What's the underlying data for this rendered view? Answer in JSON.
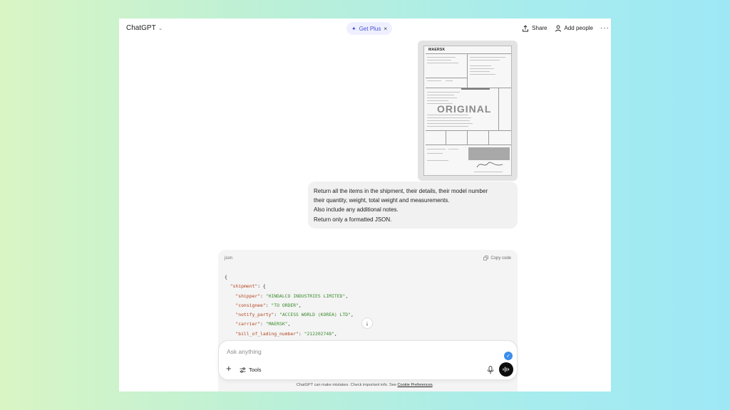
{
  "app": {
    "title": "ChatGPT",
    "get_plus_label": "Get Plus",
    "share_label": "Share",
    "add_people_label": "Add people"
  },
  "attachment": {
    "logo_text": "MAERSK",
    "watermark_text": "ORIGINAL"
  },
  "user_message": {
    "lines": [
      "Return all the items in the shipment, their details, their model number",
      "their quantity, weight, total weight and measurements.",
      "Also include any additional notes.",
      "Return only a formatted JSON."
    ]
  },
  "code_block": {
    "language": "json",
    "copy_label": "Copy code",
    "lines": [
      {
        "key": "",
        "value": "",
        "raw": "{"
      },
      {
        "key": "\"shipment\"",
        "value": "",
        "raw": "  \"shipment\": {"
      },
      {
        "key": "\"shipper\"",
        "value": "\"HINDALCO INDUSTRIES LIMITED\""
      },
      {
        "key": "\"consignee\"",
        "value": "\"TO ORDER\""
      },
      {
        "key": "\"notify_party\"",
        "value": "\"ACCESS WORLD (KOREA) LTD\""
      },
      {
        "key": "\"carrier\"",
        "value": "\"MAERSK\""
      },
      {
        "key": "\"bill_of_lading_number\"",
        "value": "\"212202748\""
      }
    ]
  },
  "composer": {
    "placeholder": "Ask anything",
    "tools_label": "Tools"
  },
  "footer": {
    "disclaimer": "ChatGPT can make mistakes. Check important info. See ",
    "cookie_link": "Cookie Preferences",
    "suffix": "."
  },
  "colors": {
    "accent": "#4a4fd6",
    "code_key": "#b3441f",
    "code_string": "#3a8a2c",
    "check_badge": "#3b8eea"
  },
  "icons": [
    "chevron-down-icon",
    "sparkle-icon",
    "close-icon",
    "share-icon",
    "person-add-icon",
    "more-icon",
    "copy-icon",
    "arrow-down-icon",
    "plus-icon",
    "tools-icon",
    "check-icon",
    "mic-icon",
    "voice-icon"
  ]
}
